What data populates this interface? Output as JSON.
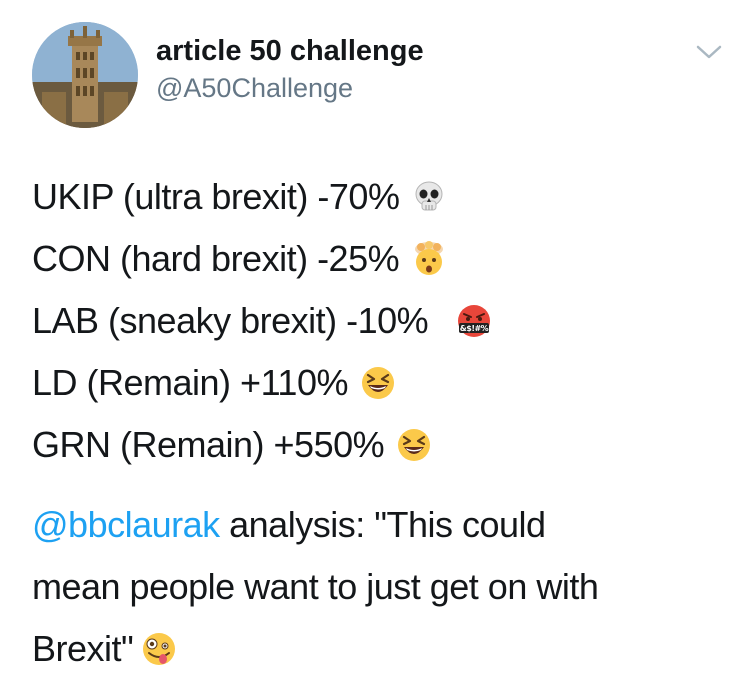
{
  "tweet": {
    "author": {
      "display_name": "article 50 challenge",
      "handle": "@A50Challenge",
      "avatar_icon": "parliament-tower-avatar"
    },
    "menu_icon": "chevron-down-icon",
    "lines": [
      {
        "text": "UKIP (ultra brexit) -70%",
        "emoji": "skull-emoji"
      },
      {
        "text": "CON (hard brexit) -25%",
        "emoji": "exploding-head-emoji"
      },
      {
        "text": "LAB (sneaky brexit) -10%",
        "emoji": "cursing-face-emoji",
        "emoji_text": "&$!#%"
      },
      {
        "text": "LD (Remain) +110%",
        "emoji": "grinning-squinting-face-emoji"
      },
      {
        "text": "GRN (Remain) +550%",
        "emoji": "grinning-squinting-face-emoji"
      }
    ],
    "analysis": {
      "mention": "@bbclaurak",
      "text_line1": " analysis: \"This could",
      "text_line2": "mean people want to just get on with",
      "text_line3": "Brexit\"",
      "emoji": "zany-face-emoji"
    },
    "colors": {
      "text": "#14171a",
      "secondary": "#657786",
      "link": "#1da1f2",
      "background": "#ffffff"
    }
  }
}
